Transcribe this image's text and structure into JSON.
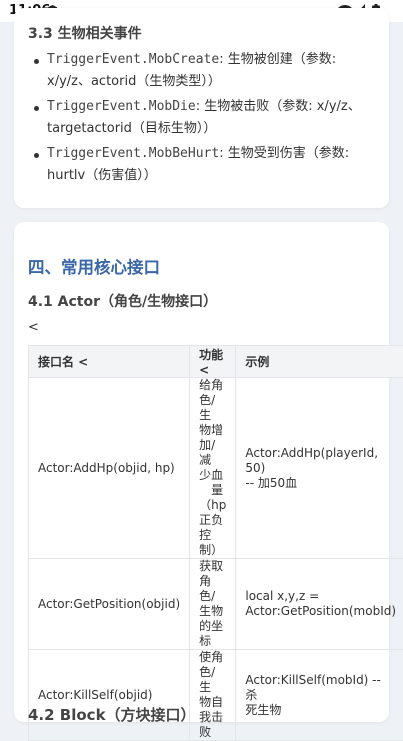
{
  "status_bar": {
    "time": "11:06"
  },
  "section33": {
    "heading": "3.3 生物相关事件",
    "items": [
      {
        "code": "TriggerEvent.MobCreate",
        "line1_rest": ": 生物被创建（参数:",
        "line2": "x/y/z、actorid（生物类型））"
      },
      {
        "code": "TriggerEvent.MobDie",
        "line1_rest": ": 生物被击败（参数: x/y/z、",
        "line2": "targetactorid（目标生物））"
      },
      {
        "code": "TriggerEvent.MobBeHurt",
        "line1_rest": ": 生物受到伤害（参数:",
        "line2": "hurtlv（伤害值））"
      }
    ]
  },
  "section4": {
    "heading": "四、常用核心接口",
    "sub_heading": "4.1 Actor（角色/生物接口）",
    "stray": "<",
    "table": {
      "headers": [
        "接口名 <",
        "功能 <",
        "示例"
      ],
      "rows": [
        {
          "name": "Actor:AddHp(objid, hp)",
          "func_lines": [
            "给角",
            "色/生",
            "物增",
            "加/减",
            "少血",
            "量",
            "（hp",
            "正负",
            "控",
            "制）"
          ],
          "example_lines": [
            "Actor:AddHp(playerId, 50)",
            "-- 加50血"
          ]
        },
        {
          "name": "Actor:GetPosition(objid)",
          "func_lines": [
            "获取",
            "角色/",
            "生物",
            "的坐",
            "标"
          ],
          "example_lines": [
            "local x,y,z =",
            "Actor:GetPosition(mobId)"
          ]
        },
        {
          "name": "Actor:KillSelf(objid)",
          "func_lines": [
            "使角",
            "色/生",
            "物自",
            "我击",
            "败"
          ],
          "example_lines": [
            "Actor:KillSelf(mobId) -- 杀",
            "死生物"
          ]
        }
      ]
    },
    "next_heading_peek": "4.2 Block（方块接口）"
  }
}
